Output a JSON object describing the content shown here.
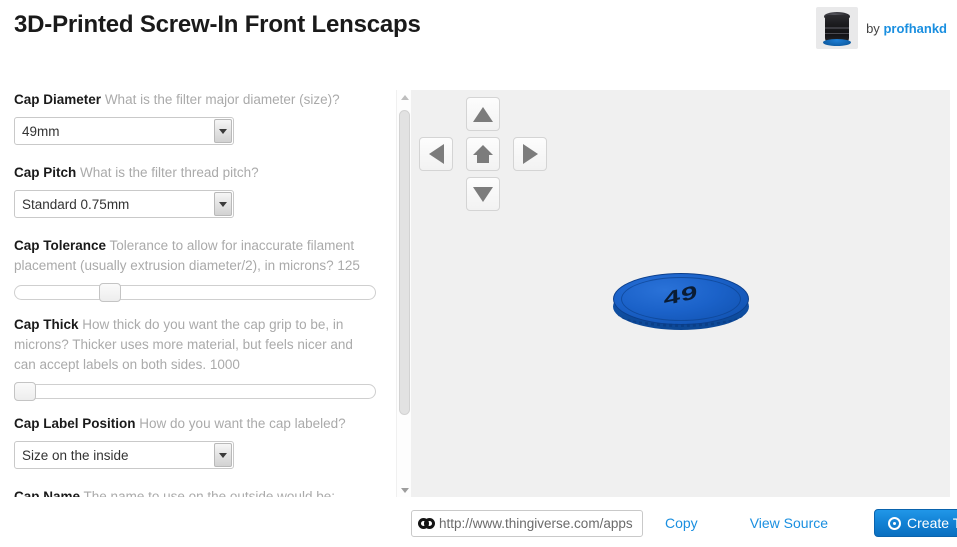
{
  "header": {
    "title": "3D-Printed Screw-In Front Lenscaps",
    "by_prefix": "by",
    "author": "profhankd",
    "avatar_alt": "camera-lens-photo"
  },
  "form": {
    "fields": [
      {
        "name": "cap-diameter",
        "label": "Cap Diameter",
        "description": "What is the filter major diameter (size)?",
        "type": "select",
        "value": "49mm"
      },
      {
        "name": "cap-pitch",
        "label": "Cap Pitch",
        "description": "What is the filter thread pitch?",
        "type": "select",
        "value": "Standard 0.75mm"
      },
      {
        "name": "cap-tolerance",
        "label": "Cap Tolerance",
        "description": "Tolerance to allow for inaccurate filament placement (usually extrusion diameter/2), in microns?",
        "type": "slider",
        "value": "125",
        "thumb_percent": 25
      },
      {
        "name": "cap-thick",
        "label": "Cap Thick",
        "description": "How thick do you want the cap grip to be, in microns? Thicker uses more material, but feels nicer and can accept labels on both sides.",
        "type": "slider",
        "value": "1000",
        "thumb_percent": 0
      },
      {
        "name": "cap-label-position",
        "label": "Cap Label Position",
        "description": "How do you want the cap labeled?",
        "type": "select",
        "value": "Size on the inside"
      },
      {
        "name": "cap-name",
        "label": "Cap Name",
        "description": "The name to use on the outside would be:",
        "type": "text",
        "value": ""
      }
    ]
  },
  "viewer": {
    "controls": [
      {
        "name": "rotate-up-button",
        "icon": "triangle-up-icon"
      },
      {
        "name": "rotate-left-button",
        "icon": "triangle-left-icon"
      },
      {
        "name": "reset-view-button",
        "icon": "home-icon"
      },
      {
        "name": "rotate-right-button",
        "icon": "triangle-right-icon"
      },
      {
        "name": "rotate-down-button",
        "icon": "triangle-down-icon"
      }
    ],
    "model_label": "49",
    "model_color": "#1b62c9",
    "background_color": "#f0f0f0"
  },
  "bottom": {
    "url_value": "http://www.thingiverse.com/apps",
    "url_icon": "chain-link-icon",
    "copy_label": "Copy",
    "view_source_label": "View Source",
    "create_label": "Create Thing",
    "create_icon": "record-circle-icon",
    "accent_color": "#1a8fe0",
    "button_color": "#1383d6"
  }
}
